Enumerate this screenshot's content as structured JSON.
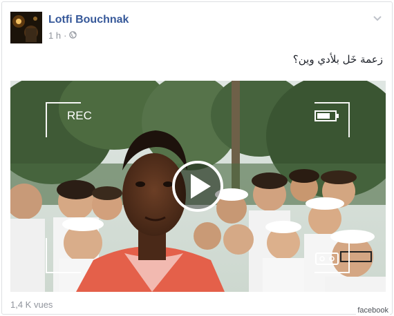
{
  "post": {
    "author": "Lotfi Bouchnak",
    "time": "1 h",
    "text": "زعمة خَل بلأدي وين؟",
    "views": "1,4 K vues"
  },
  "video": {
    "rec_label": "REC"
  },
  "credit": "facebook",
  "colors": {
    "author_link": "#365899",
    "meta_gray": "#90949c",
    "card_border": "#dddfe2"
  },
  "icons": [
    "globe-icon",
    "chevron-down-icon",
    "play-icon",
    "battery-icon",
    "cassette-icon"
  ]
}
